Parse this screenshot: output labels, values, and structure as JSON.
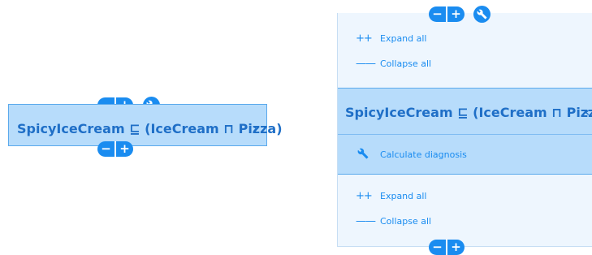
{
  "left_node": {
    "title": "SpicyIceCream ⊑ (IceCream ⊓ Pizza)",
    "chevron": "›",
    "top_controls": {
      "minus": "−",
      "plus": "+"
    },
    "bottom_controls": {
      "minus": "−",
      "plus": "+"
    }
  },
  "right_panel": {
    "top_controls": {
      "minus": "−",
      "plus": "+"
    },
    "bottom_controls": {
      "minus": "−",
      "plus": "+"
    },
    "top_menu": [
      {
        "icon": "++",
        "label": "Expand all"
      },
      {
        "icon": "——",
        "label": "Collapse all"
      }
    ],
    "node": {
      "title": "SpicyIceCream ⊑ (IceCream ⊓ Pizza)",
      "chevron": "‹",
      "action": "Calculate diagnosis"
    },
    "bottom_menu": [
      {
        "icon": "++",
        "label": "Expand all"
      },
      {
        "icon": "——",
        "label": "Collapse all"
      }
    ]
  },
  "colors": {
    "accent": "#1a8cf0",
    "node_bg": "#b7dcfb",
    "panel_bg": "#eef6fe",
    "title_text": "#1f6fc7"
  }
}
